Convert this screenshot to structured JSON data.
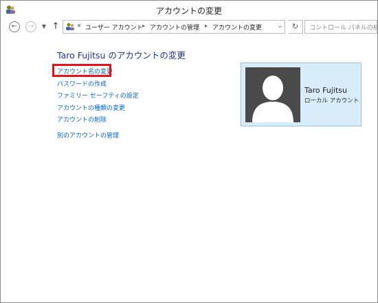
{
  "window": {
    "title": "アカウントの変更"
  },
  "nav": {
    "breadcrumbs": [
      "ユーザー アカウント",
      "アカウントの管理",
      "アカウントの変更"
    ],
    "search_placeholder": "コントロール パネルの検索"
  },
  "main": {
    "title": "Taro Fujitsu のアカウントの変更",
    "tasks": [
      "アカウント名の変更",
      "パスワードの作成",
      "ファミリー セーフティの設定",
      "アカウントの種類の変更",
      "アカウントの削除"
    ],
    "manage_other": "別のアカウントの管理"
  },
  "user": {
    "name": "Taro Fujitsu",
    "account_type": "ローカル アカウント"
  },
  "colors": {
    "highlight": "#e8101a",
    "link": "#0066cc",
    "title": "#1e3287",
    "card_bg": "#d8ecf9"
  }
}
